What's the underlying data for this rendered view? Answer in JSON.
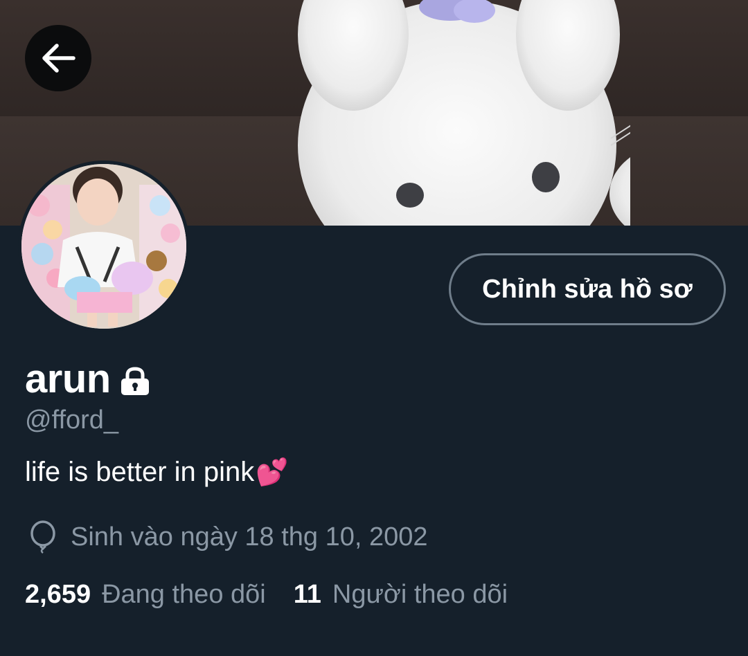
{
  "profile": {
    "display_name": "arun",
    "handle": "@fford_",
    "bio": "life is better in pink",
    "bio_emoji": "💕",
    "birth_date": "Sinh vào ngày 18 thg 10, 2002"
  },
  "actions": {
    "edit_profile_label": "Chỉnh sửa hồ sơ"
  },
  "stats": {
    "following_count": "2,659",
    "following_label": "Đang theo dõi",
    "followers_count": "11",
    "followers_label": "Người theo dõi"
  },
  "icons": {
    "back": "arrow-left-icon",
    "lock": "lock-icon",
    "birthday": "balloon-icon"
  },
  "colors": {
    "background": "#15202b",
    "secondary_text": "#8b98a5",
    "button_border": "#6f7d8a",
    "accent_heart": "#ff4fa3"
  }
}
